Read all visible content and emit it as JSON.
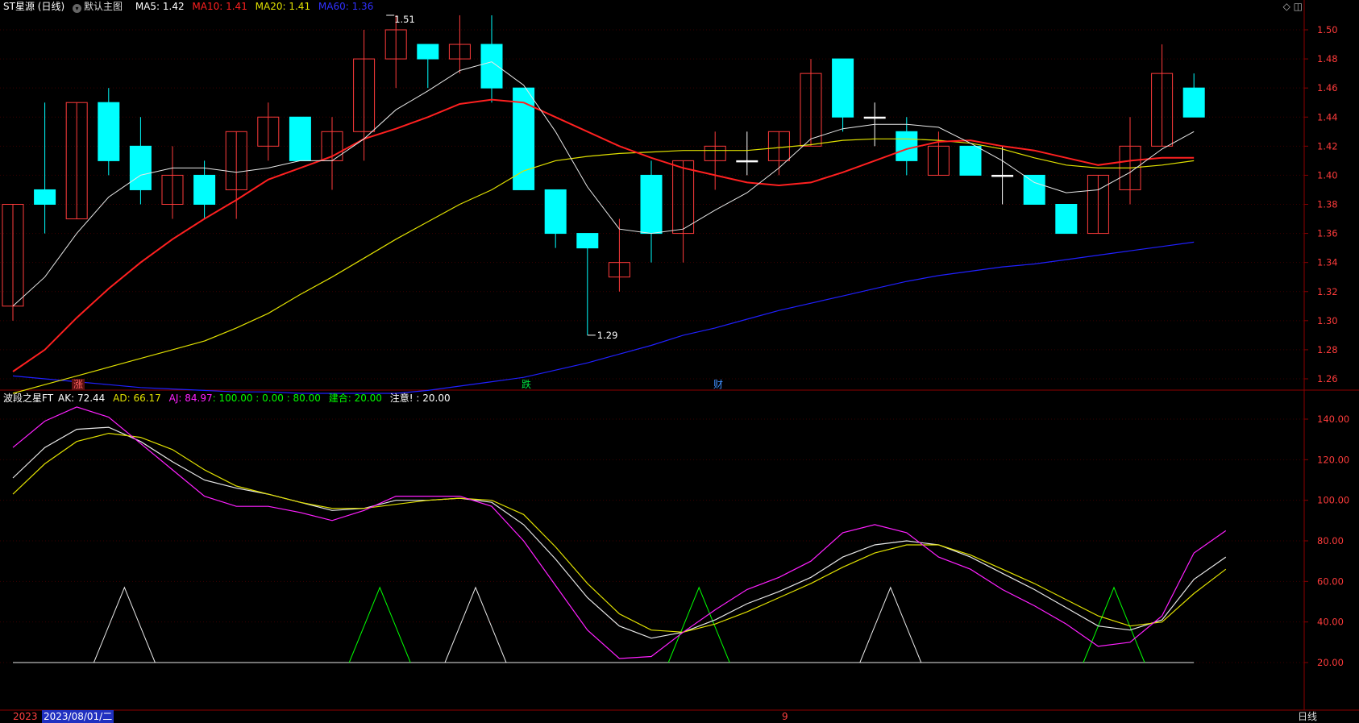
{
  "main_legend": {
    "title": "ST星源 (日线)",
    "chip": "默认主图",
    "ma5": "MA5: 1.42",
    "ma10": "MA10: 1.41",
    "ma20": "MA20: 1.41",
    "ma60": "MA60: 1.36"
  },
  "indicator_legend": {
    "name": "波段之星FT",
    "ak": "AK: 72.44",
    "ad": "AD: 66.17",
    "aj": "AJ: 84.97",
    "levels": ": 100.00 : 0.00 : 80.00",
    "jianhe": "建合: 20.00",
    "zhuyi": "注意! : 20.00"
  },
  "annotations": {
    "high": "1.51",
    "low": "1.29"
  },
  "signals": [
    {
      "text": "涨",
      "color": "#c0392b"
    },
    {
      "text": "跌",
      "color": "#00c040"
    },
    {
      "text": "财",
      "color": "#3080ff"
    }
  ],
  "top_icons": "◇ ◫",
  "date_bar": {
    "left": "2023",
    "cursor_date": "2023/08/01/二",
    "month": "9",
    "period": "日线"
  },
  "colors": {
    "up": "#ff3b3b",
    "down": "#00ffff",
    "ma5": "#e8e8e8",
    "ma10": "#ff2020",
    "ma20": "#e0e000",
    "ma60": "#2020ff",
    "aj": "#ff20ff",
    "signal_green": "#00ff00"
  },
  "chart_data": [
    {
      "type": "candlestick",
      "ylim": [
        1.24,
        1.51
      ],
      "y_ticks": [
        1.26,
        1.28,
        1.3,
        1.32,
        1.34,
        1.36,
        1.38,
        1.4,
        1.42,
        1.44,
        1.46,
        1.48,
        1.5
      ],
      "candles": [
        {
          "o": 1.31,
          "h": 1.38,
          "l": 1.3,
          "c": 1.38
        },
        {
          "o": 1.39,
          "h": 1.45,
          "l": 1.36,
          "c": 1.38
        },
        {
          "o": 1.37,
          "h": 1.45,
          "l": 1.37,
          "c": 1.45
        },
        {
          "o": 1.45,
          "h": 1.46,
          "l": 1.4,
          "c": 1.41
        },
        {
          "o": 1.42,
          "h": 1.44,
          "l": 1.38,
          "c": 1.39
        },
        {
          "o": 1.38,
          "h": 1.42,
          "l": 1.37,
          "c": 1.4
        },
        {
          "o": 1.4,
          "h": 1.41,
          "l": 1.37,
          "c": 1.38
        },
        {
          "o": 1.39,
          "h": 1.43,
          "l": 1.37,
          "c": 1.43
        },
        {
          "o": 1.42,
          "h": 1.45,
          "l": 1.41,
          "c": 1.44
        },
        {
          "o": 1.44,
          "h": 1.44,
          "l": 1.41,
          "c": 1.41
        },
        {
          "o": 1.41,
          "h": 1.44,
          "l": 1.39,
          "c": 1.43
        },
        {
          "o": 1.43,
          "h": 1.5,
          "l": 1.41,
          "c": 1.48
        },
        {
          "o": 1.48,
          "h": 1.51,
          "l": 1.46,
          "c": 1.5
        },
        {
          "o": 1.49,
          "h": 1.49,
          "l": 1.46,
          "c": 1.48
        },
        {
          "o": 1.48,
          "h": 1.51,
          "l": 1.47,
          "c": 1.49
        },
        {
          "o": 1.49,
          "h": 1.51,
          "l": 1.45,
          "c": 1.46
        },
        {
          "o": 1.46,
          "h": 1.46,
          "l": 1.39,
          "c": 1.39
        },
        {
          "o": 1.39,
          "h": 1.39,
          "l": 1.35,
          "c": 1.36
        },
        {
          "o": 1.36,
          "h": 1.36,
          "l": 1.29,
          "c": 1.35
        },
        {
          "o": 1.33,
          "h": 1.37,
          "l": 1.32,
          "c": 1.34
        },
        {
          "o": 1.4,
          "h": 1.41,
          "l": 1.34,
          "c": 1.36
        },
        {
          "o": 1.36,
          "h": 1.41,
          "l": 1.34,
          "c": 1.41
        },
        {
          "o": 1.41,
          "h": 1.43,
          "l": 1.39,
          "c": 1.42
        },
        {
          "o": 1.41,
          "h": 1.43,
          "l": 1.4,
          "c": 1.41
        },
        {
          "o": 1.41,
          "h": 1.43,
          "l": 1.4,
          "c": 1.43
        },
        {
          "o": 1.42,
          "h": 1.48,
          "l": 1.42,
          "c": 1.47
        },
        {
          "o": 1.48,
          "h": 1.48,
          "l": 1.43,
          "c": 1.44
        },
        {
          "o": 1.44,
          "h": 1.45,
          "l": 1.42,
          "c": 1.44
        },
        {
          "o": 1.43,
          "h": 1.44,
          "l": 1.4,
          "c": 1.41
        },
        {
          "o": 1.4,
          "h": 1.43,
          "l": 1.4,
          "c": 1.42
        },
        {
          "o": 1.42,
          "h": 1.42,
          "l": 1.4,
          "c": 1.4
        },
        {
          "o": 1.4,
          "h": 1.42,
          "l": 1.38,
          "c": 1.4
        },
        {
          "o": 1.4,
          "h": 1.4,
          "l": 1.38,
          "c": 1.38
        },
        {
          "o": 1.38,
          "h": 1.38,
          "l": 1.36,
          "c": 1.36
        },
        {
          "o": 1.36,
          "h": 1.4,
          "l": 1.36,
          "c": 1.4
        },
        {
          "o": 1.39,
          "h": 1.44,
          "l": 1.38,
          "c": 1.42
        },
        {
          "o": 1.42,
          "h": 1.49,
          "l": 1.42,
          "c": 1.47
        },
        {
          "o": 1.46,
          "h": 1.47,
          "l": 1.44,
          "c": 1.44
        }
      ],
      "ma5": [
        1.31,
        1.33,
        1.36,
        1.385,
        1.4,
        1.405,
        1.405,
        1.402,
        1.405,
        1.41,
        1.41,
        1.425,
        1.445,
        1.458,
        1.472,
        1.478,
        1.462,
        1.43,
        1.392,
        1.363,
        1.36,
        1.363,
        1.376,
        1.388,
        1.405,
        1.425,
        1.432,
        1.435,
        1.435,
        1.433,
        1.422,
        1.41,
        1.395,
        1.388,
        1.39,
        1.402,
        1.418,
        1.43
      ],
      "ma10": [
        1.265,
        1.28,
        1.302,
        1.322,
        1.34,
        1.356,
        1.37,
        1.383,
        1.397,
        1.405,
        1.413,
        1.425,
        1.432,
        1.44,
        1.449,
        1.452,
        1.45,
        1.44,
        1.43,
        1.42,
        1.412,
        1.405,
        1.4,
        1.395,
        1.393,
        1.395,
        1.402,
        1.41,
        1.418,
        1.423,
        1.424,
        1.42,
        1.417,
        1.412,
        1.407,
        1.41,
        1.412,
        1.412
      ],
      "ma20": [
        1.25,
        1.256,
        1.262,
        1.268,
        1.274,
        1.28,
        1.286,
        1.295,
        1.305,
        1.318,
        1.33,
        1.343,
        1.356,
        1.368,
        1.38,
        1.39,
        1.403,
        1.41,
        1.413,
        1.415,
        1.416,
        1.417,
        1.417,
        1.417,
        1.419,
        1.421,
        1.424,
        1.425,
        1.425,
        1.424,
        1.422,
        1.418,
        1.412,
        1.407,
        1.405,
        1.405,
        1.407,
        1.41
      ],
      "ma60": [
        1.262,
        1.26,
        1.258,
        1.256,
        1.254,
        1.253,
        1.252,
        1.251,
        1.251,
        1.25,
        1.25,
        1.25,
        1.25,
        1.252,
        1.255,
        1.258,
        1.261,
        1.266,
        1.271,
        1.277,
        1.283,
        1.29,
        1.295,
        1.301,
        1.307,
        1.312,
        1.317,
        1.322,
        1.327,
        1.331,
        1.334,
        1.337,
        1.339,
        1.342,
        1.345,
        1.348,
        1.351,
        1.354
      ]
    },
    {
      "type": "line",
      "ylim": [
        0,
        150
      ],
      "y_ticks": [
        20,
        40,
        60,
        80,
        100,
        120,
        140
      ],
      "series": [
        {
          "name": "AK",
          "values": [
            111,
            126,
            135,
            136,
            129,
            119,
            110,
            106,
            103,
            99,
            95,
            96,
            100,
            100,
            101,
            99,
            88,
            71,
            52,
            38,
            32,
            35,
            41,
            49,
            55,
            62,
            72,
            78,
            80,
            78,
            72,
            64,
            56,
            47,
            38,
            36,
            41,
            61,
            72
          ]
        },
        {
          "name": "AD",
          "values": [
            103,
            118,
            129,
            133,
            131,
            125,
            115,
            107,
            103,
            99,
            96,
            96,
            98,
            100,
            101,
            100,
            93,
            77,
            59,
            44,
            36,
            35,
            39,
            45,
            52,
            59,
            67,
            74,
            78,
            78,
            73,
            66,
            59,
            51,
            43,
            38,
            40,
            54,
            66
          ]
        },
        {
          "name": "AJ",
          "values": [
            126,
            139,
            146,
            141,
            128,
            115,
            102,
            97,
            97,
            94,
            90,
            95,
            102,
            102,
            102,
            97,
            80,
            58,
            36,
            22,
            23,
            35,
            46,
            56,
            62,
            70,
            84,
            88,
            84,
            72,
            66,
            56,
            48,
            39,
            28,
            30,
            43,
            74,
            85
          ]
        }
      ],
      "baseline": 20,
      "peaks": [
        {
          "index": 4,
          "color": "#e8e8e8"
        },
        {
          "index": 12,
          "color": "#00ff00"
        },
        {
          "index": 15,
          "color": "#e8e8e8"
        },
        {
          "index": 22,
          "color": "#00ff00"
        },
        {
          "index": 28,
          "color": "#e8e8e8"
        },
        {
          "index": 35,
          "color": "#00ff00"
        }
      ],
      "peak_value": 57
    }
  ]
}
